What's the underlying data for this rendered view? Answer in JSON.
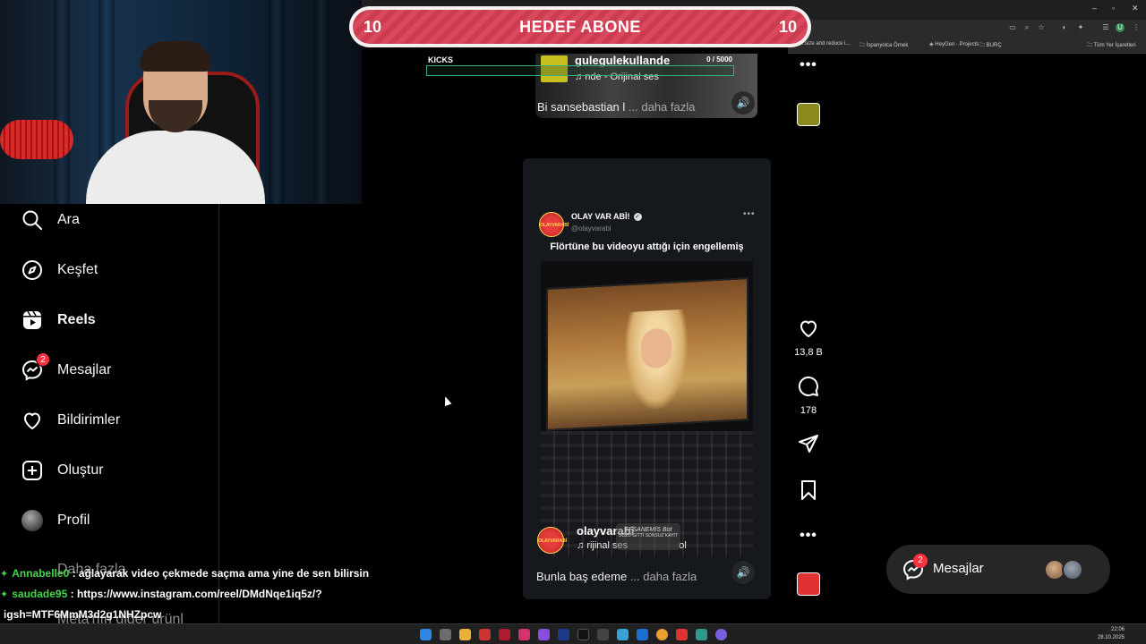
{
  "browser": {
    "bookmarks": [
      "...size and reduce i...",
      "İspanyolca Örnek",
      "HeyGen - Projects",
      "BURÇ",
      "Tüm Yer İşaretleri"
    ],
    "profile_initial": "U"
  },
  "goal": {
    "left_count": "10",
    "title": "HEDEF ABONE",
    "right_count": "10"
  },
  "kicks": {
    "label": "KICKS",
    "count": "0 / 5000",
    "progress": 0
  },
  "sidebar": {
    "items": [
      {
        "label": "Ara",
        "icon": "search-icon"
      },
      {
        "label": "Keşfet",
        "icon": "compass-icon"
      },
      {
        "label": "Reels",
        "icon": "reels-icon"
      },
      {
        "label": "Mesajlar",
        "icon": "messenger-icon",
        "badge": "2"
      },
      {
        "label": "Bildirimler",
        "icon": "heart-icon"
      },
      {
        "label": "Oluştur",
        "icon": "plus-square-icon"
      },
      {
        "label": "Profil",
        "icon": "avatar"
      }
    ],
    "more_label": "Daha fazla",
    "meta_label": "Meta'nın diğer ürünl"
  },
  "reel_top": {
    "username": "gulegulekullande",
    "audio": "nde - Orijinal ses",
    "caption": "Bi sansebastian l",
    "more": "... daha fazla"
  },
  "reel_main": {
    "post_name": "OLAY VAR ABİ!",
    "post_handle": "@olayvarabi",
    "post_avatar_text": "OLAYVARABİ",
    "headline": "Flörtüne bu videoyu attığı için engellemiş",
    "username": "olayvarabi",
    "audio": "rijinal ses",
    "audio_tail": "ol",
    "watermark_line1": "EFSANEMİS Bot",
    "watermark_line2": "SÖZÜ GİTTİ SONSUZ KAYIT",
    "caption": "Bunla baş edeme",
    "more": "... daha fazla"
  },
  "actions": {
    "likes": "13,8 B",
    "comments": "178"
  },
  "messages_pill": {
    "label": "Mesajlar",
    "badge": "2"
  },
  "chat": [
    {
      "user": "Annabelle0",
      "message": ": ağlayarak video çekmede saçma ama yine de sen bilirsin"
    },
    {
      "user": "saudade95",
      "message": ": https://www.instagram.com/reel/DMdNqe1iq5z/?"
    },
    {
      "user": "",
      "message": "igsh=MTF6MmM3d2g1NHZpcw"
    }
  ],
  "taskbar": {
    "time": "22:06",
    "date": "28.10.2025"
  },
  "colors": {
    "accent_red": "#ff3040",
    "chat_green": "#44d44a",
    "goal_pink": "#d9485c"
  }
}
